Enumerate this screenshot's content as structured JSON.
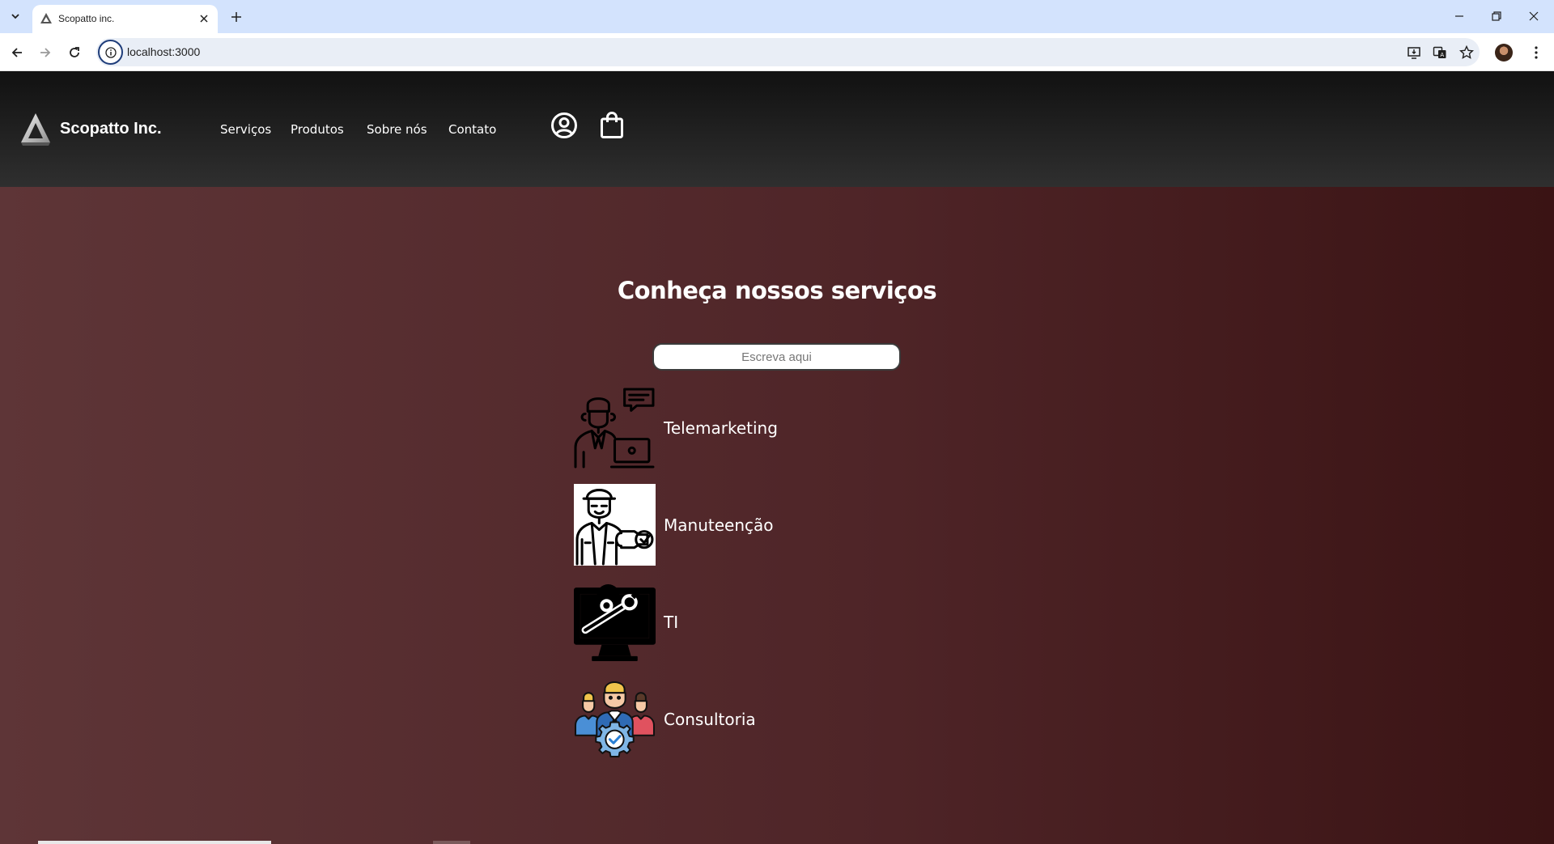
{
  "browser": {
    "tab_title": "Scopatto inc.",
    "url": "localhost:3000"
  },
  "header": {
    "brand": "Scopatto Inc.",
    "nav": [
      "Serviços",
      "Produtos",
      "Sobre nós",
      "Contato"
    ]
  },
  "main": {
    "title": "Conheça nossos serviços",
    "search_placeholder": "Escreva aqui",
    "services": [
      {
        "label": "Telemarketing",
        "icon": "telemarketing-icon"
      },
      {
        "label": "Manuteenção",
        "icon": "maintenance-icon"
      },
      {
        "label": "TI",
        "icon": "it-monitor-icon"
      },
      {
        "label": "Consultoria",
        "icon": "consulting-team-icon"
      }
    ]
  },
  "colors": {
    "header_bg": "#1a1a1a",
    "page_bg_left": "#5e3537",
    "page_bg_right": "#3a1314",
    "browser_tabbar": "#d3e3fd"
  }
}
